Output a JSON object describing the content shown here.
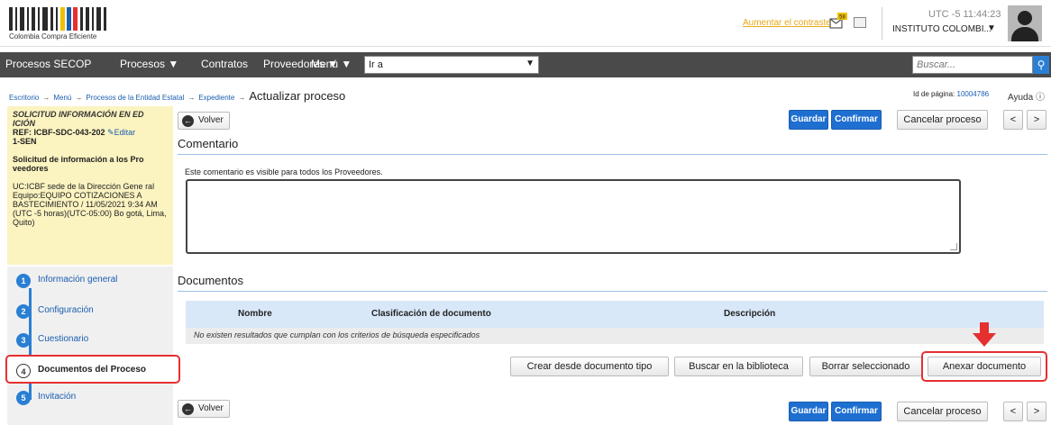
{
  "header": {
    "logo_text": "Colombia Compra Eficiente",
    "contrast_link": "Aumentar el contraste",
    "notification_count": "58",
    "time": "UTC -5 11:44:23",
    "organization": "INSTITUTO COLOMBI..."
  },
  "nav": {
    "items": [
      "Procesos SECOP",
      "Procesos ▼",
      "Contratos",
      "Proveedores ▼",
      "Menú ▼"
    ],
    "goto_value": "Ir a",
    "search_placeholder": "Buscar..."
  },
  "breadcrumb": {
    "items": [
      "Escritorio",
      "Menú",
      "Procesos de la Entidad Estatal",
      "Expediente"
    ],
    "current": "Actualizar proceso",
    "page_id_label": "Id de página:",
    "page_id": "10004786",
    "help": "Ayuda"
  },
  "summary": {
    "title": "SOLICITUD INFORMACIÓN EN ED ICIÓN",
    "ref": "REF: ICBF-SDC-043-202",
    "ref_suffix": "1-SEN",
    "edit": "Editar",
    "description": "Solicitud de información a los Pro veedores",
    "uc": "UC:ICBF sede de la Dirección Gene ral",
    "team": "Equipo:EQUIPO COTIZACIONES A BASTECIMIENTO / 11/05/2021 9:34 AM (UTC -5 horas)(UTC-05:00) Bo gotá, Lima, Quito)"
  },
  "steps": [
    {
      "num": "1",
      "label": "Información general"
    },
    {
      "num": "2",
      "label": "Configuración"
    },
    {
      "num": "3",
      "label": "Cuestionario"
    },
    {
      "num": "4",
      "label": "Documentos del Proceso"
    },
    {
      "num": "5",
      "label": "Invitación"
    }
  ],
  "toolbar": {
    "back": "Volver",
    "save": "Guardar",
    "confirm": "Confirmar",
    "cancel": "Cancelar proceso",
    "prev": "<",
    "next": ">"
  },
  "comment": {
    "title": "Comentario",
    "note": "Este comentario es visible para todos los Proveedores.",
    "value": ""
  },
  "documents": {
    "title": "Documentos",
    "columns": [
      "Nombre",
      "Clasificación de documento",
      "Descripción"
    ],
    "empty_message": "No existen resultados que cumplan con los criterios de búsqueda especificados",
    "actions": [
      "Crear desde documento tipo",
      "Buscar en la biblioteca",
      "Borrar seleccionado",
      "Anexar documento"
    ]
  },
  "colors": {
    "accent": "#1f6fd1",
    "highlight": "#e53030",
    "summary_bg": "#fbf3c0",
    "nav_bg": "#4a4a4a"
  }
}
